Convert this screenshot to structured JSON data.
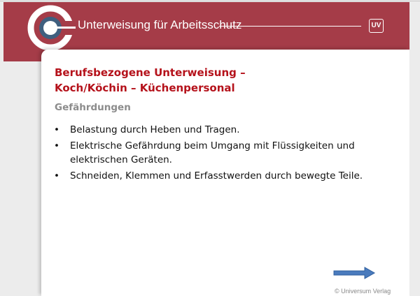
{
  "header": {
    "title": "Unterweisung für Arbeitsschutz",
    "logo_icon": "ring-target-logo-icon",
    "badge": "UV",
    "brand_color": "#a53c48"
  },
  "slide": {
    "title_line1": "Berufsbezogene Unterweisung –",
    "title_line2": "Koch/Köchin – Küchenpersonal",
    "title_color": "#b5121b",
    "subtitle": "Gefährdungen",
    "bullets": [
      "Belastung durch Heben und Tragen.",
      "Elektrische Gefährdung beim Umgang mit Flüssigkeiten und elektrischen Geräten.",
      "Schneiden, Klemmen und Erfasstwerden durch bewegte Teile."
    ],
    "bullet_glyph": "•",
    "next_icon": "arrow-right-icon",
    "copyright": "© Universum Verlag"
  }
}
